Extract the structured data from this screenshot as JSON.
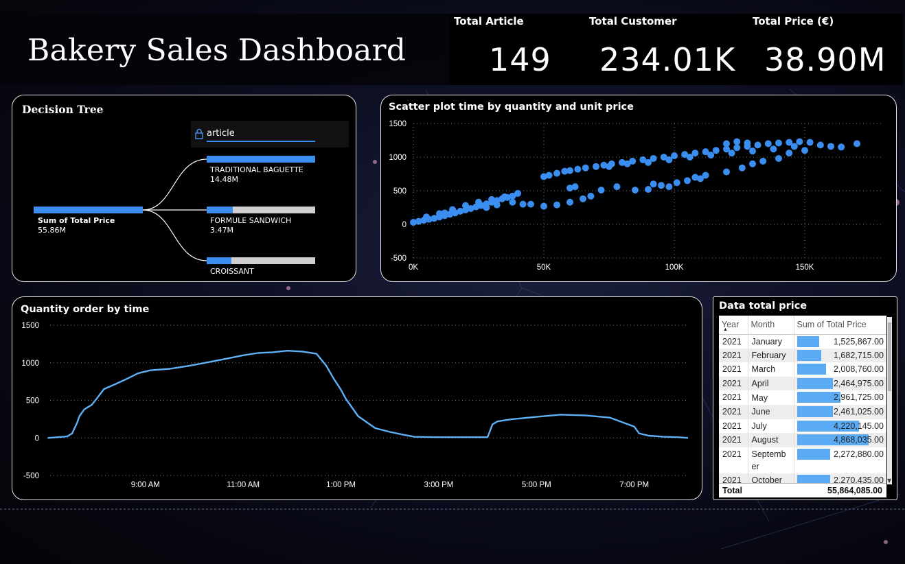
{
  "dashboard_title": "Bakery Sales Dashboard",
  "kpis": [
    {
      "label": "Total Article",
      "value": "149"
    },
    {
      "label": "Total Customer",
      "value": "234.01K"
    },
    {
      "label": "Total Price (€)",
      "value": "38.90M"
    }
  ],
  "decision_tree": {
    "title": "Decision Tree",
    "field_label": "article",
    "root": {
      "label": "Sum of Total Price",
      "value": "55.86M"
    },
    "nodes": [
      {
        "label": "TRADITIONAL BAGUETTE",
        "value": "14.48M",
        "fill": 1.0
      },
      {
        "label": "FORMULE SANDWICH",
        "value": "3.47M",
        "fill": 0.24
      },
      {
        "label": "CROISSANT",
        "value": "",
        "fill": 0.23
      }
    ]
  },
  "colors": {
    "accent": "#3a8ef0",
    "line": "#5fb0f5",
    "bar_empty": "#cfcfcf",
    "table_bar": "#5aaaf4"
  },
  "chart_data": [
    {
      "type": "scatter",
      "title": "Scatter plot time by quantity and unit price",
      "xlim": [
        0,
        180000
      ],
      "ylim": [
        -500,
        1500
      ],
      "x_ticks": [
        0,
        50000,
        100000,
        150000
      ],
      "x_tick_labels": [
        "0K",
        "50K",
        "100K",
        "150K"
      ],
      "y_ticks": [
        1500,
        1000,
        500,
        0,
        -500
      ],
      "grid": true,
      "color": "#3a8ef0",
      "points": [
        [
          0,
          30
        ],
        [
          2000,
          45
        ],
        [
          4000,
          60
        ],
        [
          6000,
          75
        ],
        [
          8000,
          90
        ],
        [
          10000,
          110
        ],
        [
          12000,
          130
        ],
        [
          14000,
          150
        ],
        [
          16000,
          170
        ],
        [
          18000,
          195
        ],
        [
          20000,
          215
        ],
        [
          22000,
          235
        ],
        [
          24000,
          260
        ],
        [
          26000,
          280
        ],
        [
          28000,
          305
        ],
        [
          30000,
          330
        ],
        [
          32000,
          355
        ],
        [
          34000,
          380
        ],
        [
          36000,
          400
        ],
        [
          10000,
          160
        ],
        [
          15000,
          220
        ],
        [
          20000,
          280
        ],
        [
          25000,
          330
        ],
        [
          30000,
          370
        ],
        [
          35000,
          410
        ],
        [
          5000,
          110
        ],
        [
          12000,
          170
        ],
        [
          28000,
          250
        ],
        [
          32000,
          290
        ],
        [
          38000,
          330
        ],
        [
          42000,
          300
        ],
        [
          40000,
          460
        ],
        [
          38000,
          420
        ],
        [
          45000,
          300
        ],
        [
          50000,
          270
        ],
        [
          55000,
          290
        ],
        [
          60000,
          330
        ],
        [
          65000,
          380
        ],
        [
          68000,
          420
        ],
        [
          72000,
          510
        ],
        [
          78000,
          560
        ],
        [
          50000,
          710
        ],
        [
          52000,
          730
        ],
        [
          55000,
          760
        ],
        [
          58000,
          790
        ],
        [
          60000,
          800
        ],
        [
          63000,
          820
        ],
        [
          66000,
          840
        ],
        [
          70000,
          860
        ],
        [
          73000,
          880
        ],
        [
          76000,
          900
        ],
        [
          80000,
          920
        ],
        [
          84000,
          940
        ],
        [
          88000,
          960
        ],
        [
          92000,
          980
        ],
        [
          96000,
          1000
        ],
        [
          100000,
          1020
        ],
        [
          104000,
          1040
        ],
        [
          108000,
          1060
        ],
        [
          112000,
          1080
        ],
        [
          116000,
          1100
        ],
        [
          120000,
          1120
        ],
        [
          124000,
          1140
        ],
        [
          128000,
          1160
        ],
        [
          132000,
          1180
        ],
        [
          136000,
          1200
        ],
        [
          140000,
          1210
        ],
        [
          144000,
          1220
        ],
        [
          148000,
          1230
        ],
        [
          152000,
          1220
        ],
        [
          156000,
          1180
        ],
        [
          160000,
          1160
        ],
        [
          164000,
          1150
        ],
        [
          170000,
          1200
        ],
        [
          75000,
          860
        ],
        [
          82000,
          900
        ],
        [
          90000,
          920
        ],
        [
          98000,
          960
        ],
        [
          106000,
          1000
        ],
        [
          114000,
          1030
        ],
        [
          122000,
          1060
        ],
        [
          130000,
          1090
        ],
        [
          138000,
          1120
        ],
        [
          146000,
          1160
        ],
        [
          92000,
          600
        ],
        [
          95000,
          580
        ],
        [
          98000,
          560
        ],
        [
          101000,
          620
        ],
        [
          105000,
          650
        ],
        [
          108000,
          700
        ],
        [
          110000,
          680
        ],
        [
          112000,
          730
        ],
        [
          120000,
          780
        ],
        [
          126000,
          840
        ],
        [
          130000,
          900
        ],
        [
          134000,
          940
        ],
        [
          140000,
          980
        ],
        [
          144000,
          1060
        ],
        [
          150000,
          1100
        ],
        [
          120000,
          1200
        ],
        [
          124000,
          1230
        ],
        [
          128000,
          1210
        ],
        [
          60000,
          540
        ],
        [
          62000,
          560
        ],
        [
          85000,
          510
        ],
        [
          90000,
          520
        ]
      ]
    },
    {
      "type": "line",
      "title": "Quantity order by time",
      "ylim": [
        -500,
        1500
      ],
      "y_ticks": [
        1500,
        1000,
        500,
        0,
        -500
      ],
      "x_ticks": [
        "9:00 AM",
        "11:00 AM",
        "1:00 PM",
        "3:00 PM",
        "5:00 PM",
        "7:00 PM"
      ],
      "x_tick_hours": [
        9,
        11,
        13,
        15,
        17,
        19
      ],
      "xlim_hours": [
        7.05,
        20.1
      ],
      "grid": true,
      "color": "#5fb0f5",
      "series": [
        {
          "hours": [
            7.0,
            7.4,
            7.5,
            7.6,
            7.65,
            7.75,
            7.9,
            8.0,
            8.15,
            8.4,
            8.6,
            8.85,
            9.1,
            9.5,
            9.9,
            10.3,
            10.7,
            11.0,
            11.3,
            11.6,
            11.9,
            12.2,
            12.5,
            12.7,
            12.85,
            13.0,
            13.1,
            13.35,
            13.7,
            14.0,
            14.3,
            14.5,
            15.0,
            15.5,
            16.0,
            16.1,
            16.2,
            16.5,
            17.0,
            17.5,
            18.0,
            18.5,
            19.0,
            19.1,
            19.3,
            19.6,
            19.9,
            20.1
          ],
          "values": [
            0,
            20,
            60,
            200,
            290,
            380,
            440,
            520,
            650,
            720,
            780,
            860,
            900,
            920,
            960,
            1010,
            1060,
            1100,
            1130,
            1140,
            1160,
            1150,
            1120,
            960,
            790,
            640,
            520,
            290,
            130,
            80,
            40,
            15,
            10,
            10,
            10,
            180,
            220,
            250,
            280,
            310,
            300,
            270,
            150,
            60,
            30,
            15,
            10,
            0
          ]
        }
      ]
    },
    {
      "type": "table",
      "title": "Data total price",
      "columns": [
        "Year",
        "Month",
        "Sum of Total Price"
      ],
      "rows": [
        {
          "year": "2021",
          "month": "January",
          "value": 1525867.0,
          "label": "1,525,867.00"
        },
        {
          "year": "2021",
          "month": "February",
          "value": 1682715.0,
          "label": "1,682,715.00"
        },
        {
          "year": "2021",
          "month": "March",
          "value": 2008760.0,
          "label": "2,008,760.00"
        },
        {
          "year": "2021",
          "month": "April",
          "value": 2464975.0,
          "label": "2,464,975.00"
        },
        {
          "year": "2021",
          "month": "May",
          "value": 2961725.0,
          "label": "2,961,725.00"
        },
        {
          "year": "2021",
          "month": "June",
          "value": 2461025.0,
          "label": "2,461,025.00"
        },
        {
          "year": "2021",
          "month": "July",
          "value": 4220145.0,
          "label": "4,220,145.00"
        },
        {
          "year": "2021",
          "month": "August",
          "value": 4868035.0,
          "label": "4,868,035.00"
        },
        {
          "year": "2021",
          "month": "Septemb er",
          "value": 2272880.0,
          "label": "2,272,880.00"
        },
        {
          "year": "2021",
          "month": "October",
          "value": 2270435.0,
          "label": "2,270,435.00"
        }
      ],
      "bar_max": 4868035.0,
      "total_label": "Total",
      "total_value": "55,864,085.00"
    }
  ]
}
